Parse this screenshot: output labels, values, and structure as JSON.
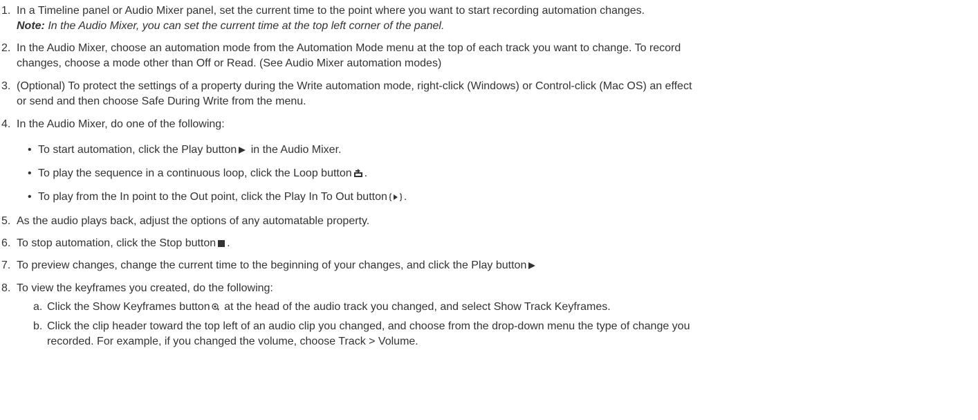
{
  "steps": [
    {
      "number": "1.",
      "lines": [
        "In a Timeline panel or Audio Mixer panel, set the current time to the point where you want to start recording automation changes."
      ],
      "note_label": "Note:",
      "note_text": " In the Audio Mixer, you can set the current time at the top left corner of the panel."
    },
    {
      "number": "2.",
      "lines": [
        "In the Audio Mixer, choose an automation mode from the Automation Mode menu at the top of each track you want to change. To record",
        "changes, choose a mode other than Off or Read. (See Audio Mixer automation modes)"
      ]
    },
    {
      "number": "3.",
      "lines": [
        "(Optional) To protect the settings of a property during the Write automation mode, right-click (Windows) or Control-click (Mac OS) an effect",
        "or send and then choose Safe During Write from the menu."
      ]
    },
    {
      "number": "4.",
      "lines": [
        "In the Audio Mixer, do one of the following:"
      ],
      "bullets": [
        {
          "bullet": "•",
          "text_before": "To start automation, click the Play button",
          "icon": "play-icon",
          "text_after": " in the Audio Mixer."
        },
        {
          "bullet": "•",
          "text_before": "To play the sequence in a continuous loop, click the Loop button",
          "icon": "loop-icon",
          "text_after": "."
        },
        {
          "bullet": "•",
          "text_before": "To play from the In point to the Out point, click the Play In To Out button",
          "icon": "play-in-to-out-icon",
          "text_after": "."
        }
      ]
    },
    {
      "number": "5.",
      "lines": [
        "As the audio plays back, adjust the options of any automatable property."
      ]
    },
    {
      "number": "6.",
      "text_before": "To stop automation, click the Stop button",
      "icon": "stop-icon",
      "text_after": "."
    },
    {
      "number": "7.",
      "text_before": "To preview changes, change the current time to the beginning of your changes, and click the Play button",
      "icon": "play-icon",
      "text_after": ""
    },
    {
      "number": "8.",
      "lines": [
        "To view the keyframes you created, do the following:"
      ],
      "substeps": [
        {
          "letter": "a.",
          "text_before": "Click the Show Keyframes button",
          "icon": "show-keyframes-icon",
          "text_after": " at the head of the audio track you changed, and select Show Track Keyframes."
        },
        {
          "letter": "b.",
          "lines": [
            "Click the clip header toward the top left of an audio clip you changed, and choose from the drop-down menu the type of change you",
            "recorded. For example, if you changed the volume, choose Track > Volume."
          ]
        }
      ]
    }
  ]
}
